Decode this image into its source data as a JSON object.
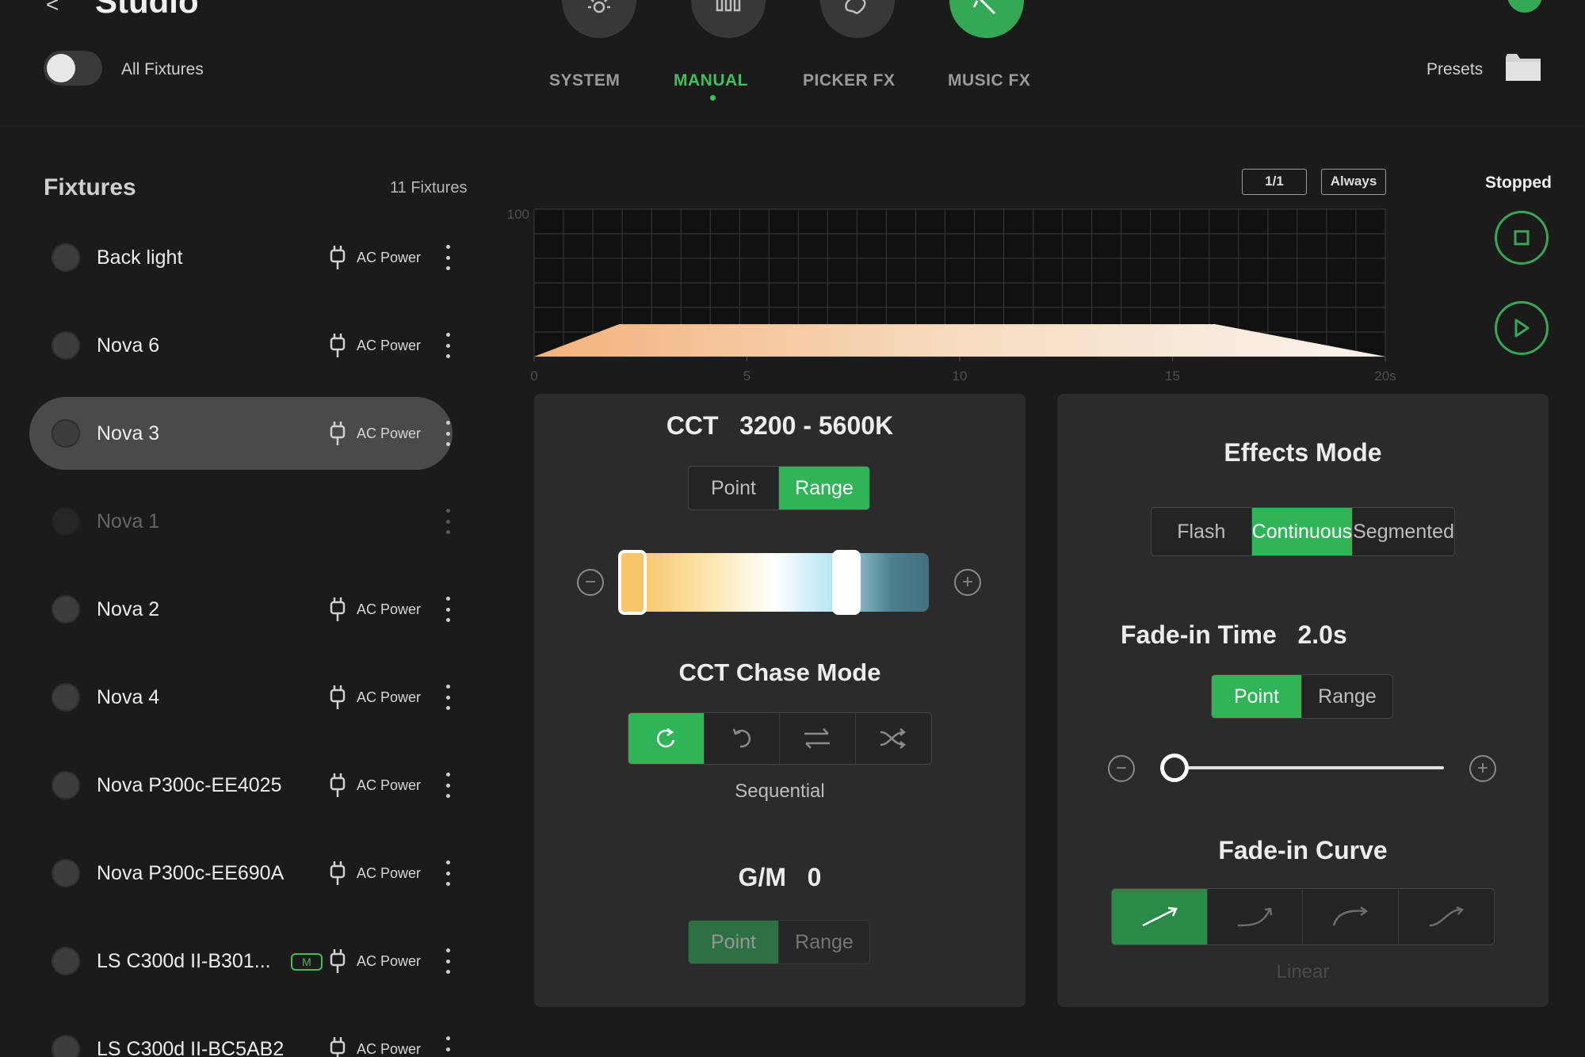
{
  "header": {
    "back": "<",
    "title": "Studio",
    "modes": [
      "brightness-icon",
      "bars-icon",
      "palette-icon",
      "magic-wand-icon"
    ]
  },
  "all_fixtures_toggle": {
    "label": "All Fixtures",
    "on": false
  },
  "tabs": [
    {
      "label": "SYSTEM",
      "active": false
    },
    {
      "label": "MANUAL",
      "active": true
    },
    {
      "label": "PICKER FX",
      "active": false
    },
    {
      "label": "MUSIC FX",
      "active": false
    }
  ],
  "presets": {
    "label": "Presets"
  },
  "sidebar": {
    "title": "Fixtures",
    "count": "11 Fixtures",
    "fixtures": [
      {
        "name": "Back light",
        "power": "AC Power"
      },
      {
        "name": "Nova 6",
        "power": "AC Power"
      },
      {
        "name": "Nova 3",
        "power": "AC Power",
        "selected": true
      },
      {
        "name": "Nova 1",
        "power": "",
        "offline": true
      },
      {
        "name": "Nova 2",
        "power": "AC Power"
      },
      {
        "name": "Nova 4",
        "power": "AC Power"
      },
      {
        "name": "Nova P300c-EE4025",
        "power": "AC Power"
      },
      {
        "name": "Nova P300c-EE690A",
        "power": "AC Power"
      },
      {
        "name": "LS C300d II-B301...",
        "badge": "M",
        "power": "AC Power"
      },
      {
        "name": "LS C300d II-BC5AB2",
        "power": "AC Power"
      }
    ]
  },
  "chart": {
    "page": "1/1",
    "repeat": "Always",
    "status": "Stopped"
  },
  "chart_data": {
    "type": "area",
    "x": [
      0,
      2,
      16,
      20
    ],
    "y": [
      0,
      22,
      22,
      0
    ],
    "ylim": [
      0,
      100
    ],
    "xlim": [
      0,
      20
    ],
    "xticks": [
      "0",
      "5",
      "10",
      "15",
      "20s"
    ],
    "yticks": [
      "100"
    ],
    "grid": true
  },
  "cct_panel": {
    "label": "CCT",
    "value": "3200 - 5600K",
    "mode_options": [
      "Point",
      "Range"
    ],
    "mode_selected": "Range",
    "range_low": 3200,
    "range_high": 5600,
    "chase_title": "CCT Chase Mode",
    "chase_modes": [
      "sequential-icon",
      "reverse-icon",
      "swap-icon",
      "shuffle-icon"
    ],
    "chase_selected_label": "Sequential",
    "gm_label": "G/M",
    "gm_value": "0",
    "gm_options": [
      "Point",
      "Range"
    ],
    "gm_selected": "Point"
  },
  "effects_panel": {
    "title": "Effects Mode",
    "modes": [
      "Flash",
      "Continuous",
      "Segmented"
    ],
    "mode_selected": "Continuous",
    "fade_label": "Fade-in Time",
    "fade_value": "2.0s",
    "fade_options": [
      "Point",
      "Range"
    ],
    "fade_selected": "Point",
    "fade_slider_fraction": 0,
    "curve_title": "Fade-in Curve",
    "curves": [
      "linear-curve-icon",
      "ease-in-curve-icon",
      "ease-out-curve-icon",
      "s-curve-icon"
    ],
    "curve_selected_label": "Linear"
  },
  "colors": {
    "accent": "#34a853",
    "background": "#1b1b1b",
    "panel": "#2b2b2b"
  }
}
